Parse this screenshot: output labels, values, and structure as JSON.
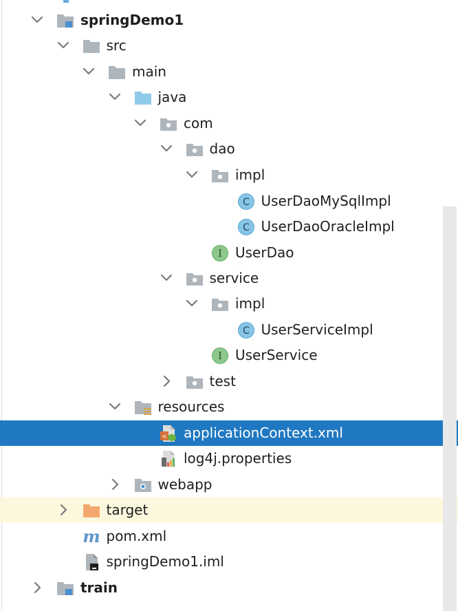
{
  "tree": {
    "nodes": [
      {
        "label": "springDemo1",
        "icon": "module-folder-icon",
        "state": "expanded"
      },
      {
        "label": "src",
        "icon": "folder-icon",
        "state": "expanded"
      },
      {
        "label": "main",
        "icon": "folder-icon",
        "state": "expanded"
      },
      {
        "label": "java",
        "icon": "source-root-folder-icon",
        "state": "expanded"
      },
      {
        "label": "com",
        "icon": "package-icon",
        "state": "expanded"
      },
      {
        "label": "dao",
        "icon": "package-icon",
        "state": "expanded"
      },
      {
        "label": "impl",
        "icon": "package-icon",
        "state": "expanded"
      },
      {
        "label": "UserDaoMySqlImpl",
        "icon": "java-class-icon",
        "state": "leaf"
      },
      {
        "label": "UserDaoOracleImpl",
        "icon": "java-class-icon",
        "state": "leaf"
      },
      {
        "label": "UserDao",
        "icon": "java-interface-icon",
        "state": "leaf"
      },
      {
        "label": "service",
        "icon": "package-icon",
        "state": "expanded"
      },
      {
        "label": "impl",
        "icon": "package-icon",
        "state": "expanded"
      },
      {
        "label": "UserServiceImpl",
        "icon": "java-class-icon",
        "state": "leaf"
      },
      {
        "label": "UserService",
        "icon": "java-interface-icon",
        "state": "leaf"
      },
      {
        "label": "test",
        "icon": "package-icon",
        "state": "collapsed"
      },
      {
        "label": "resources",
        "icon": "resources-folder-icon",
        "state": "expanded"
      },
      {
        "label": "applicationContext.xml",
        "icon": "spring-xml-file-icon",
        "state": "leaf",
        "selected": true
      },
      {
        "label": "log4j.properties",
        "icon": "properties-file-icon",
        "state": "leaf"
      },
      {
        "label": "webapp",
        "icon": "web-folder-icon",
        "state": "collapsed"
      },
      {
        "label": "target",
        "icon": "excluded-folder-icon",
        "state": "collapsed"
      },
      {
        "label": "pom.xml",
        "icon": "maven-pom-icon",
        "state": "leaf"
      },
      {
        "label": "springDemo1.iml",
        "icon": "iml-file-icon",
        "state": "leaf"
      },
      {
        "label": "train",
        "icon": "module-folder-icon",
        "state": "collapsed"
      }
    ]
  },
  "colors": {
    "selection": "#1f78c1",
    "highlight": "#fbf8dd",
    "folder": "#aeb5bb",
    "source_folder": "#8fcbe8",
    "excluded_folder": "#f4a86f",
    "class_circle": "#86c5e6",
    "interface_circle": "#8cc88c"
  }
}
